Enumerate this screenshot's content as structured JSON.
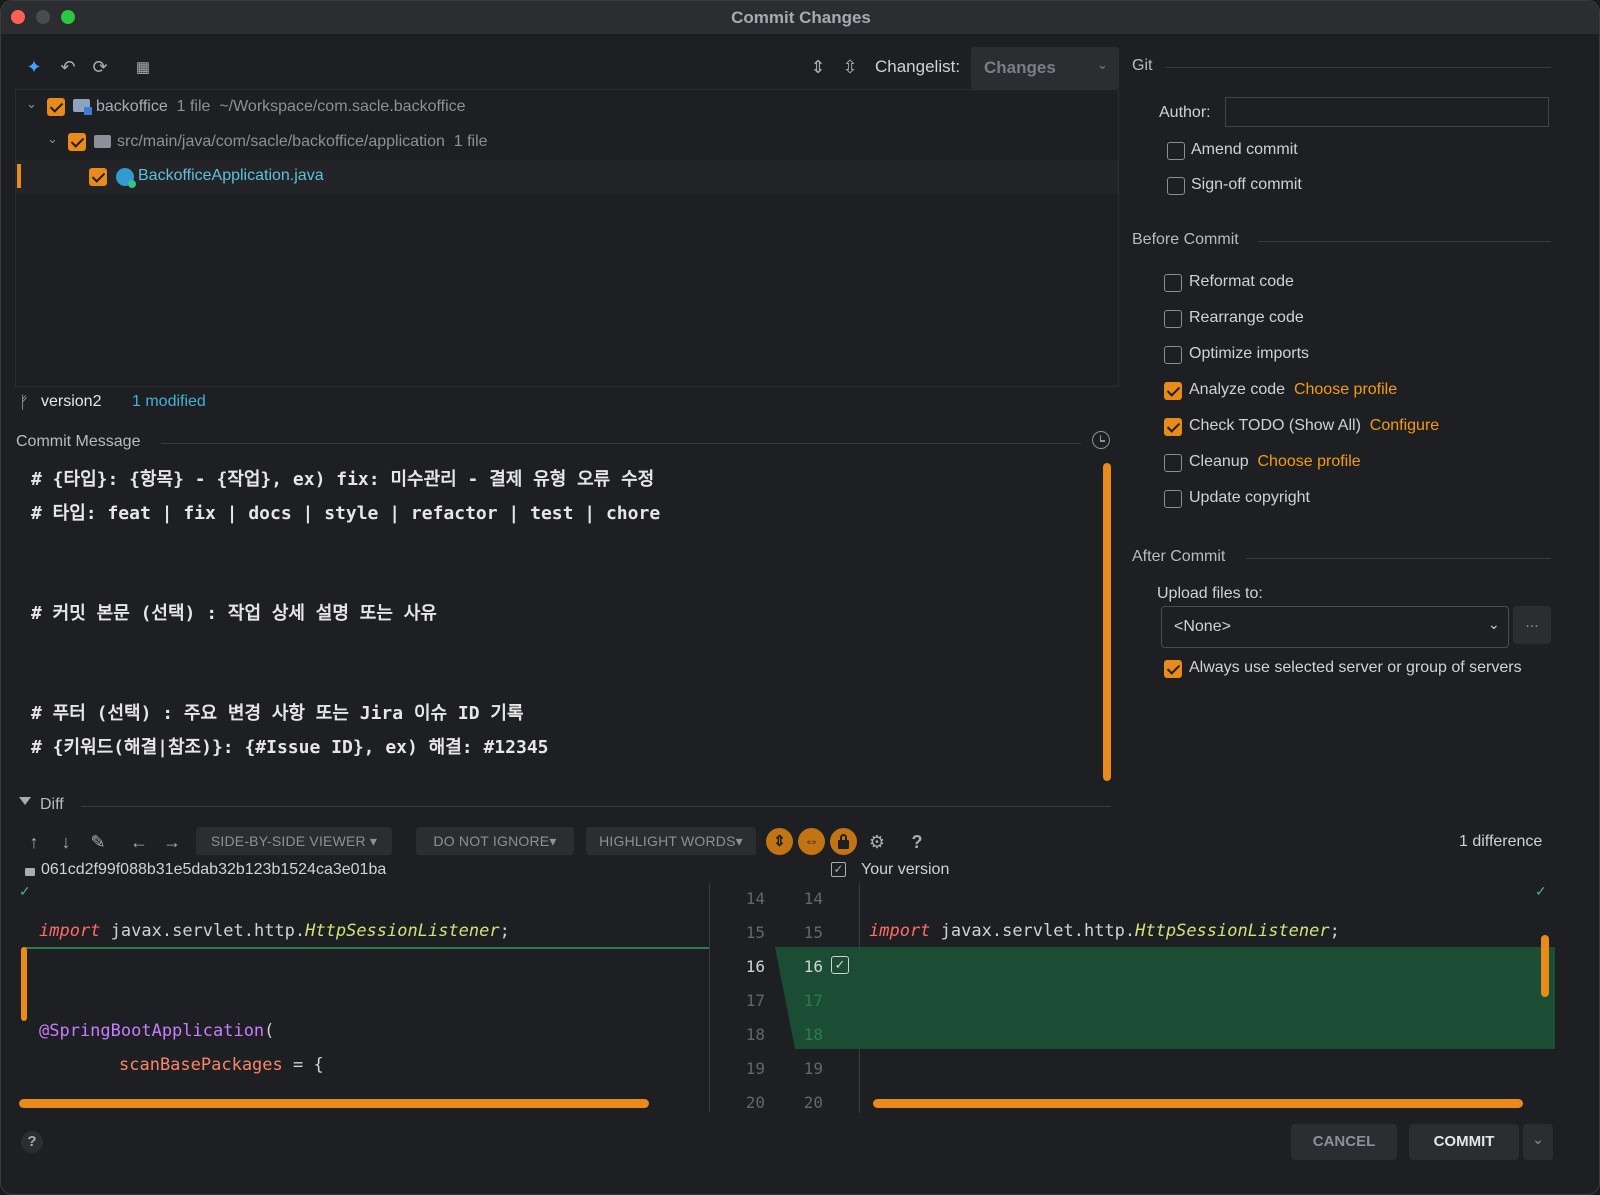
{
  "window": {
    "title": "Commit Changes"
  },
  "toolbar": {
    "changelist_label": "Changelist:",
    "changelist_value": "Changes"
  },
  "tree": {
    "root": {
      "name": "backoffice",
      "count": "1 file",
      "path": "~/Workspace/com.sacle.backoffice"
    },
    "folder": {
      "name": "src/main/java/com/sacle/backoffice/application",
      "count": "1 file"
    },
    "file": {
      "name": "BackofficeApplication.java"
    }
  },
  "status": {
    "branch": "version2",
    "modified": "1 modified"
  },
  "commit_message": {
    "label": "Commit Message",
    "lines": [
      "# {타입}: {항목} - {작업}, ex) fix: 미수관리 - 결제 유형 오류 수정",
      "# 타입: feat | fix | docs | style | refactor | test | chore",
      "# 커밋 본문 (선택) : 작업 상세 설명 또는 사유",
      "# 푸터 (선택) : 주요 변경 사항 또는 Jira 이슈 ID 기록",
      "# {키워드(해결|참조)}: {#Issue ID}, ex) 해결: #12345"
    ]
  },
  "git": {
    "section": "Git",
    "author_label": "Author:",
    "author_value": "",
    "amend": "Amend commit",
    "signoff": "Sign-off commit"
  },
  "before_commit": {
    "section": "Before Commit",
    "reformat": "Reformat code",
    "rearrange": "Rearrange code",
    "optimize": "Optimize imports",
    "analyze": "Analyze code",
    "analyze_link": "Choose profile",
    "todo": "Check TODO (Show All)",
    "todo_link": "Configure",
    "cleanup": "Cleanup",
    "cleanup_link": "Choose profile",
    "copyright": "Update copyright"
  },
  "after_commit": {
    "section": "After Commit",
    "upload_label": "Upload files to:",
    "upload_value": "<None>",
    "more": "...",
    "always": "Always use selected server or group of servers"
  },
  "diff": {
    "label": "Diff",
    "viewer": "SIDE-BY-SIDE VIEWER",
    "ignore": "DO NOT IGNORE",
    "highlight": "HIGHLIGHT WORDS",
    "help": "?",
    "differences": "1 difference",
    "hash": "061cd2f99f088b31e5dab32b123b1524ca3e01ba",
    "your_version": "Your version",
    "left_lines": [
      "14",
      "15",
      "16",
      "17",
      "18",
      "19",
      "20"
    ],
    "right_lines": [
      "14",
      "15",
      "16",
      "17",
      "18",
      "19",
      "20"
    ],
    "code": {
      "import_kw": "import",
      "import_pkg": "javax.servlet.http.",
      "import_cls": "HttpSessionListener",
      "semi": ";",
      "annotation": "@SpringBootApplication",
      "paren": "(",
      "field": "scanBasePackages",
      "assign": " = {"
    }
  },
  "footer": {
    "help": "?",
    "cancel": "CANCEL",
    "commit": "COMMIT"
  },
  "colors": {
    "accent": "#e98b1a",
    "link": "#f39c12",
    "added_bg": "#1b4d35",
    "bg": "#1e1f22"
  }
}
